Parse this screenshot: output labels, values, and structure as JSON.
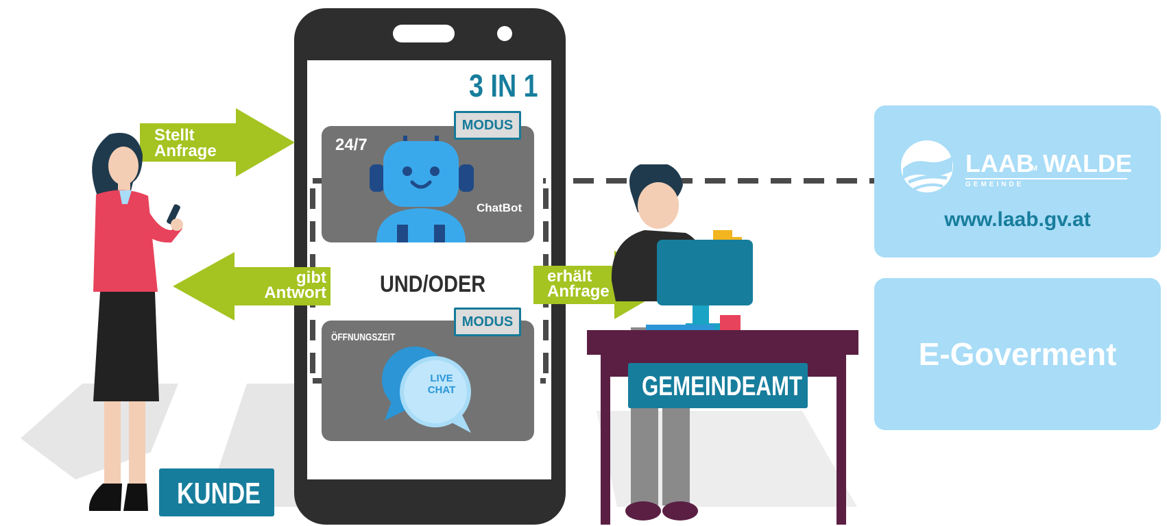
{
  "colors": {
    "green": "#a5c321",
    "teal": "#177d9c",
    "phone": "#2e2e2e",
    "panel": "#a8dcf7",
    "card": "#737373",
    "robot": "#3aa9ec"
  },
  "phone": {
    "title": "3 IN 1",
    "modus_top": "MODUS",
    "modus_bottom": "MODUS",
    "chatbot_hours": "24/7",
    "chatbot_label": "ChatBot",
    "connector": "UND/ODER",
    "livechat_hours": "ÖFFNUNGSZEIT",
    "livechat_line1": "LIVE",
    "livechat_line2": "CHAT"
  },
  "arrows": {
    "request_line1": "Stellt",
    "request_line2": "Anfrage",
    "answer_line1": "gibt",
    "answer_line2": "Antwort",
    "receive_line1": "erhält",
    "receive_line2": "Anfrage"
  },
  "labels": {
    "customer": "KUNDE",
    "office": "GEMEINDEAMT"
  },
  "panels": {
    "logo_main": "LAAB",
    "logo_small": "IM",
    "logo_end": "WALDE",
    "logo_sub": "GEMEINDE",
    "url": "www.laab.gv.at",
    "egov": "E-Goverment"
  }
}
